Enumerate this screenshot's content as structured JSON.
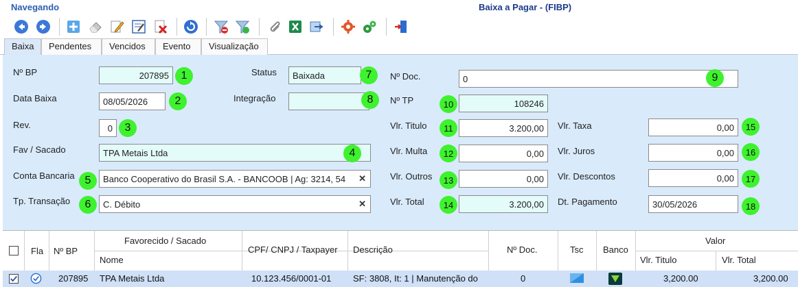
{
  "window": {
    "left_title": "Navegando",
    "center_title": "Baixa a Pagar - (FIBP)"
  },
  "toolbar": {
    "buttons": [
      {
        "name": "back-button",
        "icon": "arrow-left-icon"
      },
      {
        "name": "forward-button",
        "icon": "arrow-right-icon"
      },
      {
        "name": "new-button",
        "icon": "plus-icon"
      },
      {
        "name": "clear-button",
        "icon": "eraser-icon"
      },
      {
        "name": "edit-button",
        "icon": "pencil-icon"
      },
      {
        "name": "edit-form-button",
        "icon": "form-edit-icon"
      },
      {
        "name": "delete-button",
        "icon": "delete-doc-icon"
      },
      {
        "name": "refresh-button",
        "icon": "refresh-icon"
      },
      {
        "name": "filter-remove-button",
        "icon": "filter-remove-icon"
      },
      {
        "name": "filter-button",
        "icon": "filter-icon"
      },
      {
        "name": "attach-button",
        "icon": "paperclip-icon"
      },
      {
        "name": "excel-button",
        "icon": "excel-icon"
      },
      {
        "name": "export-button",
        "icon": "export-icon"
      },
      {
        "name": "settings-button",
        "icon": "gear-icon"
      },
      {
        "name": "actions-button",
        "icon": "gears-icon"
      },
      {
        "name": "exit-button",
        "icon": "exit-door-icon"
      }
    ]
  },
  "tabs": [
    "Baixa",
    "Pendentes",
    "Vencidos",
    "Evento",
    "Visualização"
  ],
  "form": {
    "nbp": {
      "label": "Nº BP",
      "value": "207895",
      "badge": "1"
    },
    "data_baixa": {
      "label": "Data Baixa",
      "value": "08/05/2026",
      "badge": "2"
    },
    "rev": {
      "label": "Rev.",
      "value": "0",
      "badge": "3"
    },
    "fav": {
      "label": "Fav / Sacado",
      "value": "TPA Metais Ltda",
      "badge": "4"
    },
    "conta": {
      "label": "Conta Bancaria",
      "value": "Banco Cooperativo do Brasil S.A. - BANCOOB | Ag: 3214, 54",
      "badge": "5"
    },
    "tp_transacao": {
      "label": "Tp. Transação",
      "value": "C. Débito",
      "badge": "6"
    },
    "status": {
      "label": "Status",
      "value": "Baixada",
      "badge": "7"
    },
    "integracao": {
      "label": "Integração",
      "value": "",
      "badge": "8"
    },
    "ndoc": {
      "label": "Nº Doc.",
      "value": "0",
      "badge": "9"
    },
    "ntp": {
      "label": "Nº TP",
      "value": "108246",
      "badge": "10"
    },
    "vlr_titulo": {
      "label": "Vlr. Titulo",
      "value": "3.200,00",
      "badge": "11"
    },
    "vlr_multa": {
      "label": "Vlr. Multa",
      "value": "0,00",
      "badge": "12"
    },
    "vlr_outros": {
      "label": "Vlr. Outros",
      "value": "0,00",
      "badge": "13"
    },
    "vlr_total": {
      "label": "Vlr. Total",
      "value": "3.200,00",
      "badge": "14"
    },
    "vlr_taxa": {
      "label": "Vlr. Taxa",
      "value": "0,00",
      "badge": "15"
    },
    "vlr_juros": {
      "label": "Vlr. Juros",
      "value": "0,00",
      "badge": "16"
    },
    "vlr_descontos": {
      "label": "Vlr. Descontos",
      "value": "0,00",
      "badge": "17"
    },
    "dt_pagamento": {
      "label": "Dt. Pagamento",
      "value": "30/05/2026",
      "badge": "18"
    }
  },
  "grid": {
    "headers": {
      "fla": "Fla",
      "nbp": "Nº BP",
      "fav_group": "Favorecido / Sacado",
      "nome": "Nome",
      "cpf": "CPF/ CNPJ / Taxpayer",
      "descricao": "Descrição",
      "ndoc": "Nº Doc.",
      "tsc": "Tsc",
      "banco": "Banco",
      "valor_group": "Valor",
      "vlr_titulo": "Vlr. Titulo",
      "vlr_total": "Vlr. Total"
    },
    "rows": [
      {
        "nbp": "207895",
        "nome": "TPA Metais Ltda",
        "cpf": "10.123.456/0001-01",
        "descricao": "SF: 3808, It: 1 | Manutenção do",
        "ndoc": "0",
        "vlr_titulo": "3,200.00",
        "vlr_total": "3,200.00"
      }
    ]
  },
  "colors": {
    "form_bg": "#d9eafb",
    "cyan_field": "#e3fbf9",
    "badge": "#3ef22e",
    "title_blue": "#2a5db0",
    "row_selected": "#cfe0f7"
  }
}
